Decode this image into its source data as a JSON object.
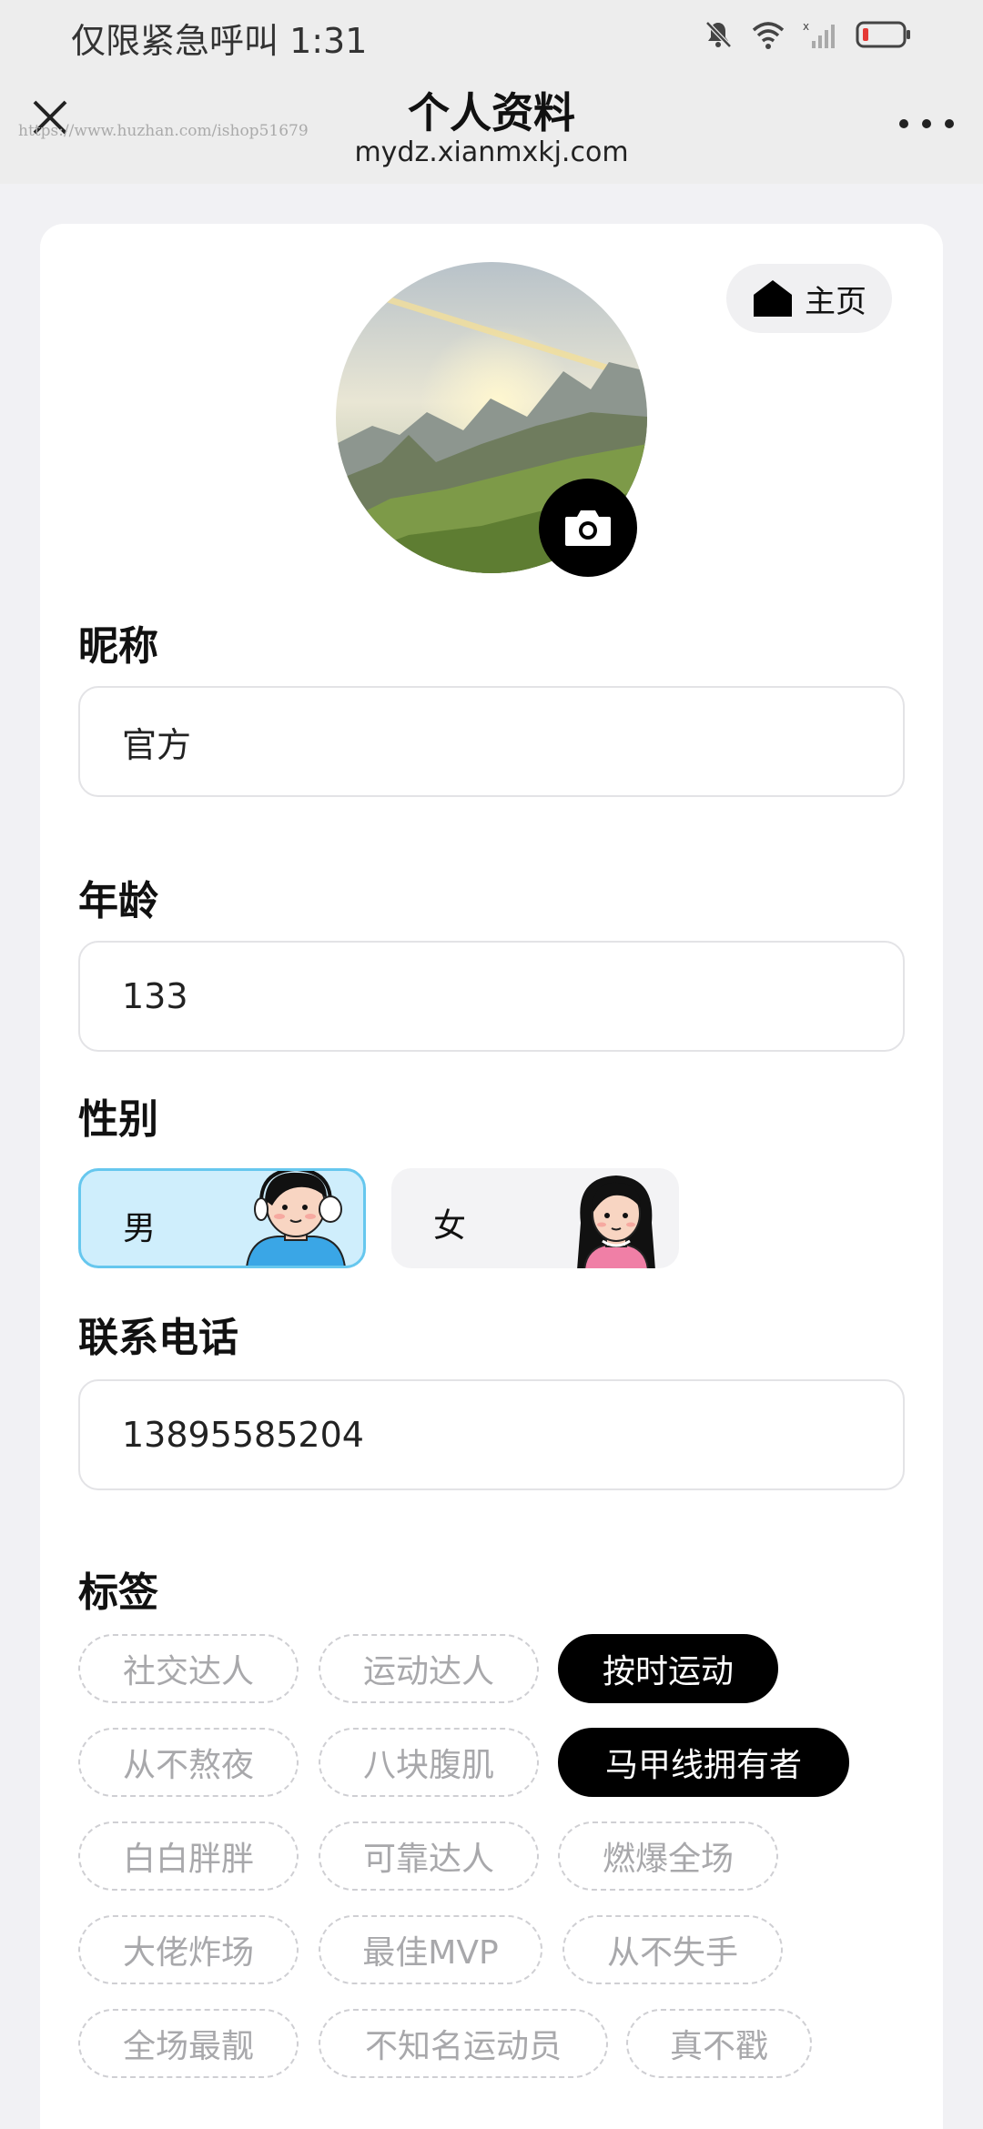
{
  "status_bar": {
    "text": "仅限紧急呼叫 1:31"
  },
  "nav": {
    "title": "个人资料",
    "url": "mydz.xianmxkj.com",
    "watermark": "https://www.huzhan.com/ishop51679"
  },
  "profile": {
    "home_label": "主页",
    "nickname_label": "昵称",
    "nickname_value": "官方",
    "age_label": "年龄",
    "age_value": "133",
    "gender_label": "性别",
    "gender_options": [
      "男",
      "女"
    ],
    "gender_selected": "男",
    "phone_label": "联系电话",
    "phone_value": "13895585204",
    "tags_label": "标签"
  },
  "tags": [
    {
      "label": "社交达人",
      "selected": false
    },
    {
      "label": "运动达人",
      "selected": false
    },
    {
      "label": "按时运动",
      "selected": true
    },
    {
      "label": "从不熬夜",
      "selected": false
    },
    {
      "label": "八块腹肌",
      "selected": false
    },
    {
      "label": "马甲线拥有者",
      "selected": true
    },
    {
      "label": "白白胖胖",
      "selected": false
    },
    {
      "label": "可靠达人",
      "selected": false
    },
    {
      "label": "燃爆全场",
      "selected": false
    },
    {
      "label": "大佬炸场",
      "selected": false
    },
    {
      "label": "最佳MVP",
      "selected": false
    },
    {
      "label": "从不失手",
      "selected": false
    },
    {
      "label": "全场最靓",
      "selected": false
    },
    {
      "label": "不知名运动员",
      "selected": false
    },
    {
      "label": "真不戳",
      "selected": false
    }
  ],
  "colors": {
    "accent_selected": "#000000",
    "male_bg": "#cfeefc",
    "male_border": "#66c7ee",
    "battery_low": "#e53935"
  }
}
